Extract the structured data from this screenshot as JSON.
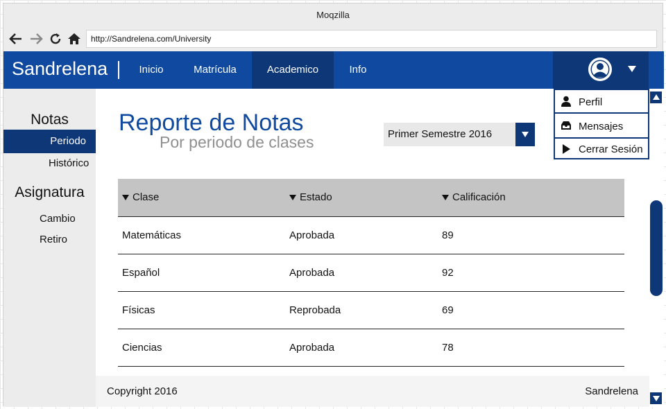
{
  "browser": {
    "window_title": "Moqzilla",
    "url": "http://Sandrelena.com/University"
  },
  "navbar": {
    "brand": "Sandrelena",
    "items": [
      {
        "label": "Inicio"
      },
      {
        "label": "Matrícula"
      },
      {
        "label": "Academico",
        "active": true
      },
      {
        "label": "Info"
      }
    ],
    "user_icon": "user-circle-icon",
    "user_caret_icon": "caret-down-icon"
  },
  "user_menu": {
    "items": [
      {
        "label": "Perfil",
        "icon": "person-icon"
      },
      {
        "label": "Mensajes",
        "icon": "inbox-icon"
      },
      {
        "label": "Cerrar Sesión",
        "icon": "play-arrow-icon"
      }
    ]
  },
  "sidebar": {
    "sections": [
      {
        "heading": "Notas",
        "items": [
          {
            "label": "Periodo",
            "active": true
          },
          {
            "label": "Histórico"
          }
        ]
      },
      {
        "heading": "Asignatura",
        "items": [
          {
            "label": "Cambio"
          },
          {
            "label": "Retiro"
          }
        ]
      }
    ]
  },
  "main": {
    "title": "Reporte de Notas",
    "subtitle": "Por periodo de clases",
    "period_select": {
      "value": "Primer Semestre 2016"
    },
    "table": {
      "columns": [
        "Clase",
        "Estado",
        "Calificación"
      ],
      "rows": [
        [
          "Matemáticas",
          "Aprobada",
          "89"
        ],
        [
          "Español",
          "Aprobada",
          "92"
        ],
        [
          "Físicas",
          "Reprobada",
          "69"
        ],
        [
          "Ciencias",
          "Aprobada",
          "78"
        ]
      ]
    }
  },
  "footer": {
    "copyright": "Copyright 2016",
    "brand": "Sandrelena"
  },
  "colors": {
    "primary": "#0f4aa0",
    "primary_dark": "#0d3777",
    "subtitle_gray": "#8f8f8f",
    "table_header": "#c4c4c4"
  }
}
